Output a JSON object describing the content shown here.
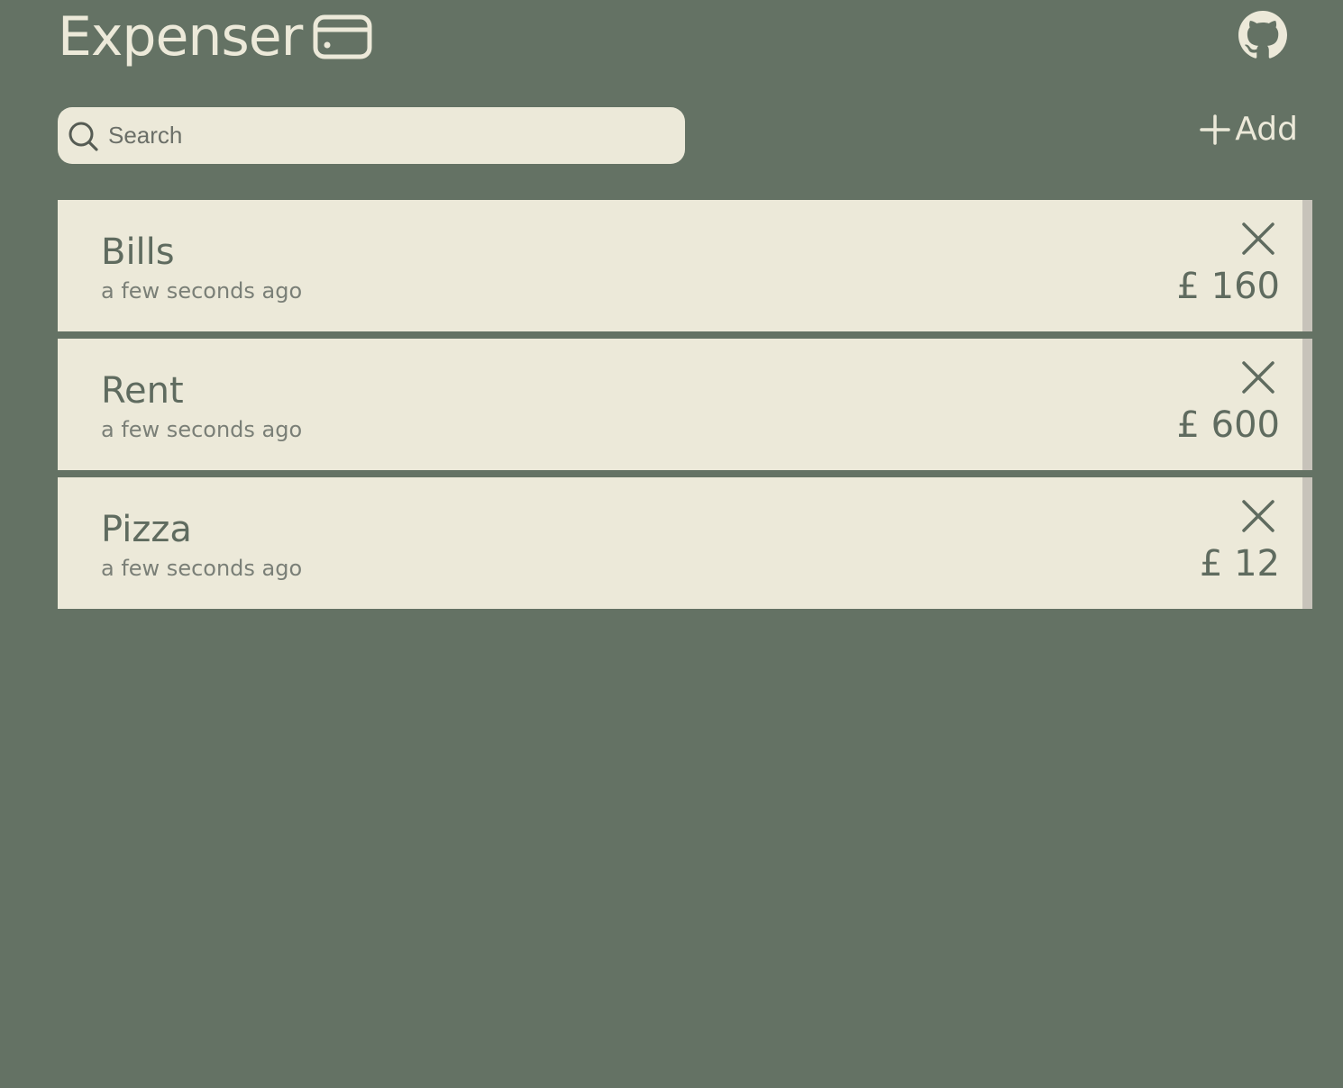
{
  "app": {
    "title": "Expenser",
    "brand_icon": "credit-card-icon",
    "github_icon": "github-icon"
  },
  "toolbar": {
    "search_placeholder": "Search",
    "search_value": "",
    "add_label": "Add",
    "add_icon": "plus-icon"
  },
  "expenses": [
    {
      "name": "Bills",
      "time": "a few seconds ago",
      "amount": "£ 160"
    },
    {
      "name": "Rent",
      "time": "a few seconds ago",
      "amount": "£ 600"
    },
    {
      "name": "Pizza",
      "time": "a few seconds ago",
      "amount": "£ 12"
    }
  ],
  "colors": {
    "background": "#647264",
    "card": "#ece9d9",
    "text": "#5f6b5f",
    "muted": "#7a7f77",
    "scrollbar": "#c7c3ba"
  }
}
